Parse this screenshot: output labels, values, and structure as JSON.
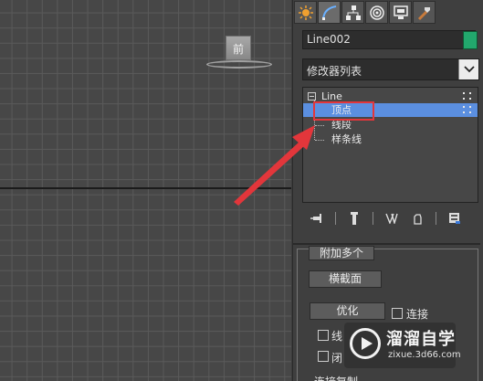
{
  "viewport": {
    "viewcube_label": "前"
  },
  "panel": {
    "tabs": [
      {
        "icon": "create-icon"
      },
      {
        "icon": "modify-icon"
      },
      {
        "icon": "hierarchy-icon"
      },
      {
        "icon": "motion-icon"
      },
      {
        "icon": "display-icon"
      },
      {
        "icon": "utilities-icon"
      }
    ],
    "object_name": "Line002",
    "object_color": "#22a86d",
    "modifier_list_label": "修改器列表",
    "stack": {
      "root": "Line",
      "items": [
        "顶点",
        "线段",
        "样条线"
      ],
      "selected": "顶点"
    },
    "rollout": {
      "attach_mult_label": "附加多个",
      "cross_section_label": "横截面",
      "optimize_label": "优化",
      "connect_label": "连接",
      "check2_label": "线",
      "check3_label": "闭",
      "bottom_label": "连接复制"
    }
  },
  "watermark": {
    "title": "溜溜自学",
    "subtitle": "zixue.3d66.com"
  },
  "colors": {
    "selection": "#5b8fe0",
    "highlight_box": "#e2363b",
    "arrow": "#e2363b"
  }
}
